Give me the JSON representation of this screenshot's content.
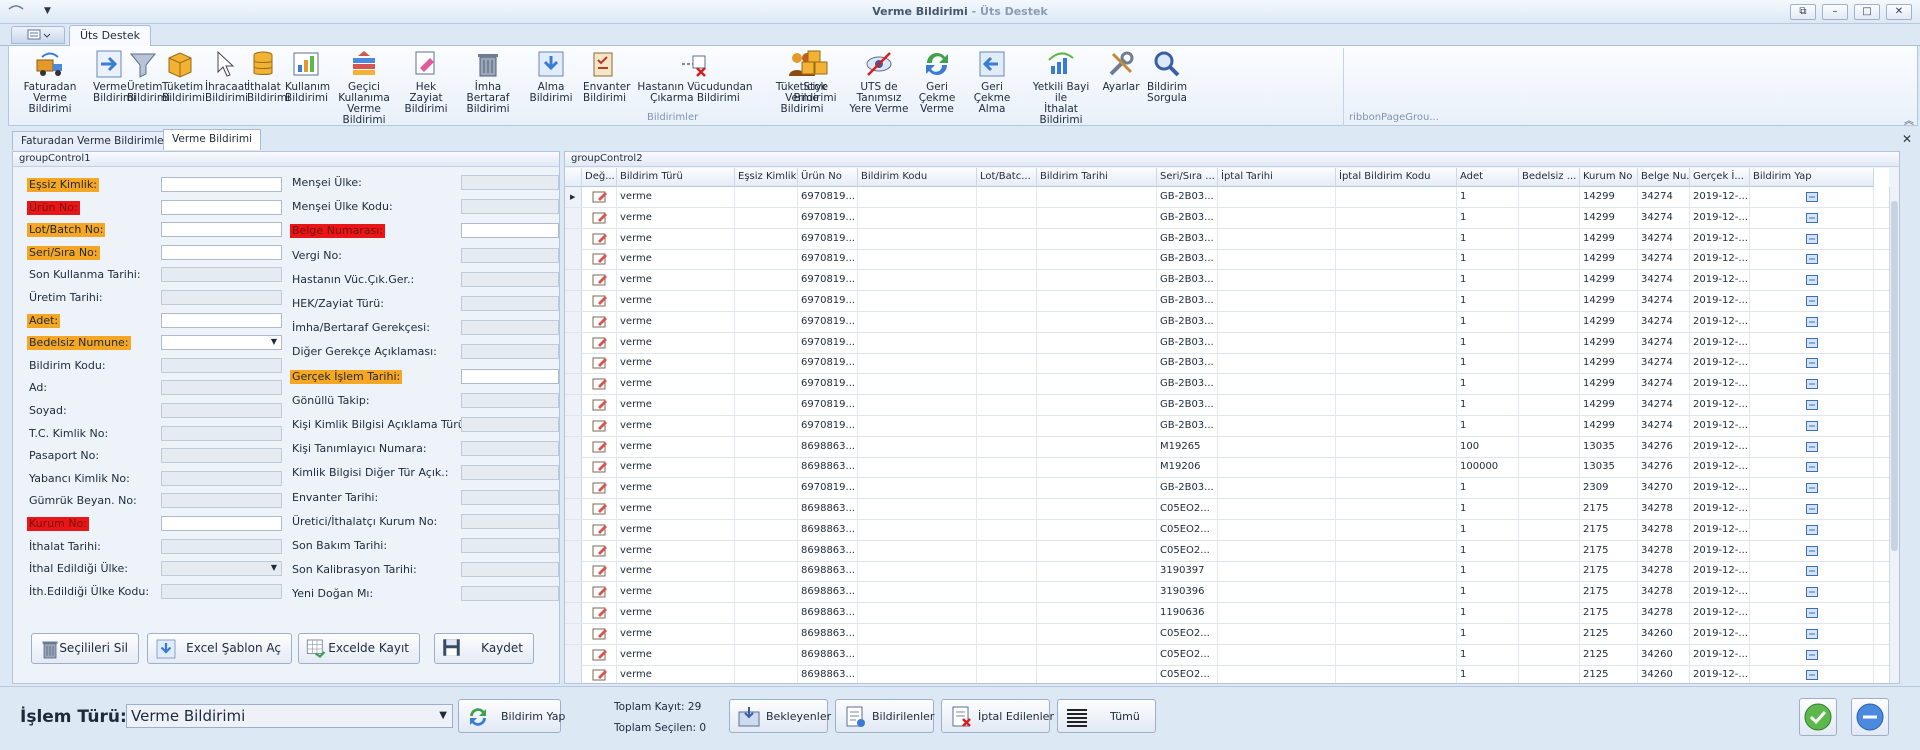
{
  "window": {
    "title": "Verme Bildirimi",
    "subtitle": " - Üts Destek"
  },
  "ribbon": {
    "tab": "Üts Destek",
    "group1_label": "Bildirimler",
    "group2_label": "ribbonPageGrou...",
    "buttons": [
      {
        "l1": "Faturadan Verme",
        "l2": "Bildirimi",
        "icon": "truck-icon"
      },
      {
        "l1": "Verme",
        "l2": "Bildirimi",
        "icon": "arrow-right-icon"
      },
      {
        "l1": "Üretim",
        "l2": "Bildirimi",
        "icon": "funnel-icon"
      },
      {
        "l1": "Tüketim",
        "l2": "Bildirimi",
        "icon": "box-icon"
      },
      {
        "l1": "İhracaat",
        "l2": "Bildirimi",
        "icon": "cursor-icon"
      },
      {
        "l1": "İthalat",
        "l2": "Bildirimi",
        "icon": "database-icon"
      },
      {
        "l1": "Kullanım",
        "l2": "Bildirimi",
        "icon": "chart-icon"
      },
      {
        "l1": "Geçici Kullanıma",
        "l2": "Verme Bildirimi",
        "icon": "stack-icon"
      },
      {
        "l1": "Hek Zayiat",
        "l2": "Bildirimi",
        "icon": "eraser-icon"
      },
      {
        "l1": "İmha Bertaraf",
        "l2": "Bildirimi",
        "icon": "trash-icon"
      },
      {
        "l1": "Alma Bildirimi",
        "l2": "",
        "icon": "download-icon"
      },
      {
        "l1": "Envanter",
        "l2": "Bildirimi",
        "icon": "clipboard-icon"
      },
      {
        "l1": "Hastanın Vücudundan",
        "l2": "Çıkarma Bildirimi",
        "icon": "remove-icon"
      },
      {
        "l1": "Tüketiciye",
        "l2": "Verme Bildirimi",
        "icon": "people-icon"
      },
      {
        "l1": "Stok Bildirimi",
        "l2": "",
        "icon": "boxes-icon"
      },
      {
        "l1": "UTS de Tanımsız",
        "l2": "Yere Verme",
        "icon": "hidden-eye-icon"
      },
      {
        "l1": "Geri Çekme",
        "l2": "Verme",
        "icon": "refresh-icon"
      },
      {
        "l1": "Geri Çekme",
        "l2": "Alma",
        "icon": "back-icon"
      },
      {
        "l1": "Yetkili Bayi ile",
        "l2": "İthalat Bildirimi",
        "icon": "chart-arrow-icon"
      },
      {
        "l1": "Ayarlar",
        "l2": "",
        "icon": "tools-icon"
      },
      {
        "l1": "Bildirim",
        "l2": "Sorgula",
        "icon": "magnifier-icon"
      }
    ]
  },
  "doc_tabs": [
    "Faturadan Verme Bildirimleri",
    "Verme Bildirimi"
  ],
  "left_panel": {
    "title": "groupControl1",
    "col1": [
      {
        "label": "Eşsiz Kimlik:",
        "style": "req",
        "input": "white"
      },
      {
        "label": "Ürün No:",
        "style": "err",
        "input": "white"
      },
      {
        "label": "Lot/Batch No:",
        "style": "req",
        "input": "white"
      },
      {
        "label": "Seri/Sıra No:",
        "style": "req",
        "input": "white"
      },
      {
        "label": "Son Kullanma Tarihi:",
        "style": "",
        "input": "dis"
      },
      {
        "label": "Üretim Tarihi:",
        "style": "",
        "input": "dis"
      },
      {
        "label": "Adet:",
        "style": "req",
        "input": "white"
      },
      {
        "label": "Bedelsiz Numune:",
        "style": "req",
        "input": "drop"
      },
      {
        "label": "Bildirim Kodu:",
        "style": "",
        "input": "dis"
      },
      {
        "label": "Ad:",
        "style": "",
        "input": "dis"
      },
      {
        "label": "Soyad:",
        "style": "",
        "input": "dis"
      },
      {
        "label": "T.C. Kimlik No:",
        "style": "",
        "input": "dis"
      },
      {
        "label": "Pasaport No:",
        "style": "",
        "input": "dis"
      },
      {
        "label": "Yabancı Kimlik No:",
        "style": "",
        "input": "dis"
      },
      {
        "label": "Gümrük Beyan. No:",
        "style": "",
        "input": "dis"
      },
      {
        "label": "Kurum No:",
        "style": "err",
        "input": "white"
      },
      {
        "label": "İthalat Tarihi:",
        "style": "",
        "input": "dis"
      },
      {
        "label": "İthal Edildiği Ülke:",
        "style": "",
        "input": "disdrop"
      },
      {
        "label": "İth.Edildiği Ülke Kodu:",
        "style": "",
        "input": "dis"
      }
    ],
    "col2": [
      {
        "label": "Menşei Ülke:",
        "style": "",
        "input": "dis"
      },
      {
        "label": "Menşei Ülke Kodu:",
        "style": "",
        "input": "dis"
      },
      {
        "label": "Belge Numarası:",
        "style": "err",
        "input": "white"
      },
      {
        "label": "Vergi No:",
        "style": "",
        "input": "dis"
      },
      {
        "label": "Hastanın Vüc.Çık.Ger.:",
        "style": "",
        "input": "dis"
      },
      {
        "label": "HEK/Zayiat Türü:",
        "style": "",
        "input": "dis"
      },
      {
        "label": "İmha/Bertaraf Gerekçesi:",
        "style": "",
        "input": "dis"
      },
      {
        "label": "Diğer Gerekçe Açıklaması:",
        "style": "",
        "input": "dis"
      },
      {
        "label": "Gerçek İşlem Tarihi:",
        "style": "req",
        "input": "white"
      },
      {
        "label": "Gönüllü Takip:",
        "style": "",
        "input": "dis"
      },
      {
        "label": "Kişi Kimlik Bilgisi Açıklama Türü:",
        "style": "",
        "input": "dis"
      },
      {
        "label": "Kişi Tanımlayıcı Numara:",
        "style": "",
        "input": "dis"
      },
      {
        "label": "Kimlik Bilgisi Diğer Tür Açık.:",
        "style": "",
        "input": "dis"
      },
      {
        "label": "Envanter Tarihi:",
        "style": "",
        "input": "dis"
      },
      {
        "label": "Üretici/İthalatçı Kurum No:",
        "style": "",
        "input": "dis"
      },
      {
        "label": "Son Bakım Tarihi:",
        "style": "",
        "input": "dis"
      },
      {
        "label": "Son Kalibrasyon Tarihi:",
        "style": "",
        "input": "dis"
      },
      {
        "label": "Yeni Doğan Mı:",
        "style": "",
        "input": "dis"
      }
    ],
    "buttons": [
      {
        "label": "Seçilileri Sil",
        "icon": "trash-icon"
      },
      {
        "label": "Excel Şablon Aç",
        "icon": "download-icon"
      },
      {
        "label": "Excelde Kayıt",
        "icon": "excel-icon"
      },
      {
        "label": "Kaydet",
        "icon": "save-icon"
      }
    ]
  },
  "grid": {
    "title": "groupControl2",
    "columns": [
      "Değ...",
      "Bildirim Türü",
      "Eşsiz Kimlik",
      "Ürün No",
      "Bildirim Kodu",
      "Lot/Batc...",
      "Bildirim Tarihi",
      "Seri/Sıra ...",
      "İptal Tarihi",
      "İptal Bildirim Kodu",
      "Adet",
      "Bedelsiz ...",
      "Kurum No",
      "Belge Nu...",
      "Gerçek İ...",
      "Bildirim Yap"
    ],
    "rows": [
      [
        "verme",
        "6970819...",
        "GB-2B03...",
        "1",
        "14299",
        "34274",
        "2019-12-..."
      ],
      [
        "verme",
        "6970819...",
        "GB-2B03...",
        "1",
        "14299",
        "34274",
        "2019-12-..."
      ],
      [
        "verme",
        "6970819...",
        "GB-2B03...",
        "1",
        "14299",
        "34274",
        "2019-12-..."
      ],
      [
        "verme",
        "6970819...",
        "GB-2B03...",
        "1",
        "14299",
        "34274",
        "2019-12-..."
      ],
      [
        "verme",
        "6970819...",
        "GB-2B03...",
        "1",
        "14299",
        "34274",
        "2019-12-..."
      ],
      [
        "verme",
        "6970819...",
        "GB-2B03...",
        "1",
        "14299",
        "34274",
        "2019-12-..."
      ],
      [
        "verme",
        "6970819...",
        "GB-2B03...",
        "1",
        "14299",
        "34274",
        "2019-12-..."
      ],
      [
        "verme",
        "6970819...",
        "GB-2B03...",
        "1",
        "14299",
        "34274",
        "2019-12-..."
      ],
      [
        "verme",
        "6970819...",
        "GB-2B03...",
        "1",
        "14299",
        "34274",
        "2019-12-..."
      ],
      [
        "verme",
        "6970819...",
        "GB-2B03...",
        "1",
        "14299",
        "34274",
        "2019-12-..."
      ],
      [
        "verme",
        "6970819...",
        "GB-2B03...",
        "1",
        "14299",
        "34274",
        "2019-12-..."
      ],
      [
        "verme",
        "6970819...",
        "GB-2B03...",
        "1",
        "14299",
        "34274",
        "2019-12-..."
      ],
      [
        "verme",
        "8698863...",
        "M19265",
        "100",
        "13035",
        "34276",
        "2019-12-..."
      ],
      [
        "verme",
        "8698863...",
        "M19206",
        "100000",
        "13035",
        "34276",
        "2019-12-..."
      ],
      [
        "verme",
        "6970819...",
        "GB-2B03...",
        "1",
        "2309",
        "34270",
        "2019-12-..."
      ],
      [
        "verme",
        "8698863...",
        "C05EO2...",
        "1",
        "2175",
        "34278",
        "2019-12-..."
      ],
      [
        "verme",
        "8698863...",
        "C05EO2...",
        "1",
        "2175",
        "34278",
        "2019-12-..."
      ],
      [
        "verme",
        "8698863...",
        "C05EO2...",
        "1",
        "2175",
        "34278",
        "2019-12-..."
      ],
      [
        "verme",
        "8698863...",
        "3190397",
        "1",
        "2175",
        "34278",
        "2019-12-..."
      ],
      [
        "verme",
        "8698863...",
        "3190396",
        "1",
        "2175",
        "34278",
        "2019-12-..."
      ],
      [
        "verme",
        "8698863...",
        "1190636",
        "1",
        "2175",
        "34278",
        "2019-12-..."
      ],
      [
        "verme",
        "8698863...",
        "C05EO2...",
        "1",
        "2125",
        "34260",
        "2019-12-..."
      ],
      [
        "verme",
        "8698863...",
        "C05EO2...",
        "1",
        "2125",
        "34260",
        "2019-12-..."
      ],
      [
        "verme",
        "8698863...",
        "C05EO2...",
        "1",
        "2125",
        "34260",
        "2019-12-..."
      ]
    ]
  },
  "bottom": {
    "islem_label": "İşlem Türü:",
    "islem_value": "Verme Bildirimi",
    "bildirim_yap": "Bildirim Yap",
    "toplam_kayit": "Toplam Kayıt: 29",
    "toplam_secilen": "Toplam Seçilen: 0",
    "filters": [
      "Bekleyenler",
      "Bildirilenler",
      "İptal Edilenler",
      "Tümü"
    ]
  }
}
